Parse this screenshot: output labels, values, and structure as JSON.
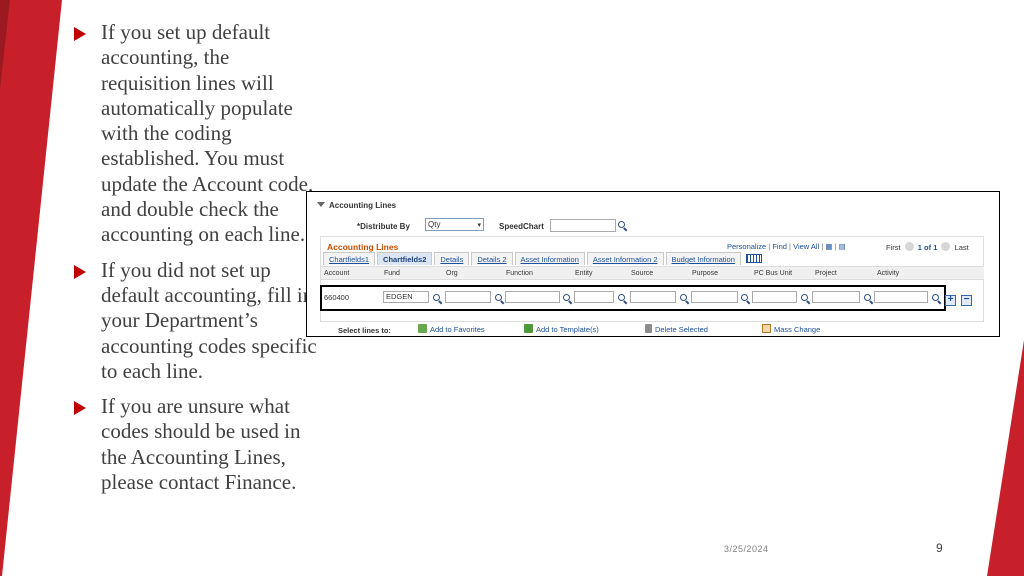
{
  "theme": {
    "accent": "#c00000",
    "link": "#1c4f9c",
    "section_title": "#cc4b00"
  },
  "bullets": [
    "If you set up default accounting, the requisition lines will automatically populate with the coding established. You must update the Account code, and double check the accounting on each line.",
    "If you did not set up default accounting, fill in your Department’s accounting codes specific to each line.",
    "If you are unsure what codes should be used in the Accounting Lines, please contact Finance."
  ],
  "screenshot": {
    "section_label": "Accounting Lines",
    "distribute_by_label": "*Distribute By",
    "distribute_by_value": "Qty",
    "speedchart_label": "SpeedChart",
    "grid_title": "Accounting Lines",
    "grid_links": {
      "personalize": "Personalize",
      "find": "Find",
      "view_all": "View All"
    },
    "grid_nav": {
      "first": "First",
      "range": "1 of 1",
      "last": "Last"
    },
    "tabs": [
      "Chartfields1",
      "Chartfields2",
      "Details",
      "Details 2",
      "Asset Information",
      "Asset Information 2",
      "Budget Information"
    ],
    "active_tab": "Chartfields2",
    "columns": [
      "Account",
      "Fund",
      "Org",
      "Function",
      "Entity",
      "Source",
      "Purpose",
      "PC Bus Unit",
      "Project",
      "Activity"
    ],
    "row": {
      "account": "660400",
      "fund": "EDGEN"
    },
    "select_lines_label": "Select lines to:",
    "actions": [
      "Add to Favorites",
      "Add to Template(s)",
      "Delete Selected",
      "Mass Change"
    ]
  },
  "footer": {
    "date": "3/25/2024",
    "page": "9"
  }
}
